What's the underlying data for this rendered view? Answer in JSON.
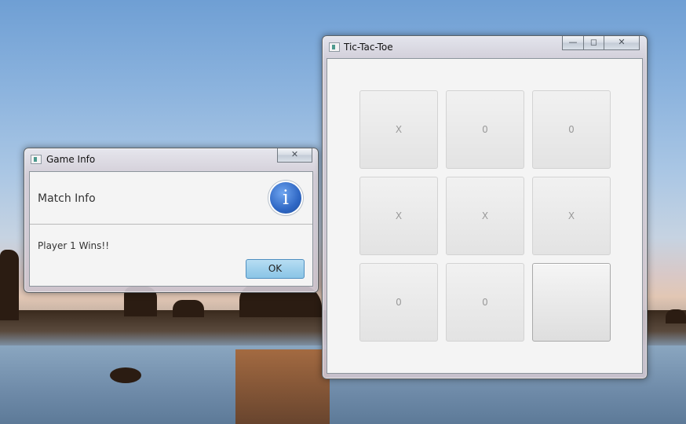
{
  "dialog": {
    "title": "Game Info",
    "header": "Match Info",
    "icon": "info-icon",
    "message": "Player 1 Wins!!",
    "ok_label": "OK",
    "close_glyph": "✕"
  },
  "game_window": {
    "title": "Tic-Tac-Toe",
    "minimize_glyph": "—",
    "maximize_glyph": "◻",
    "close_glyph": "✕",
    "board": {
      "cells": [
        "X",
        "0",
        "0",
        "X",
        "X",
        "X",
        "0",
        "0",
        ""
      ]
    }
  }
}
